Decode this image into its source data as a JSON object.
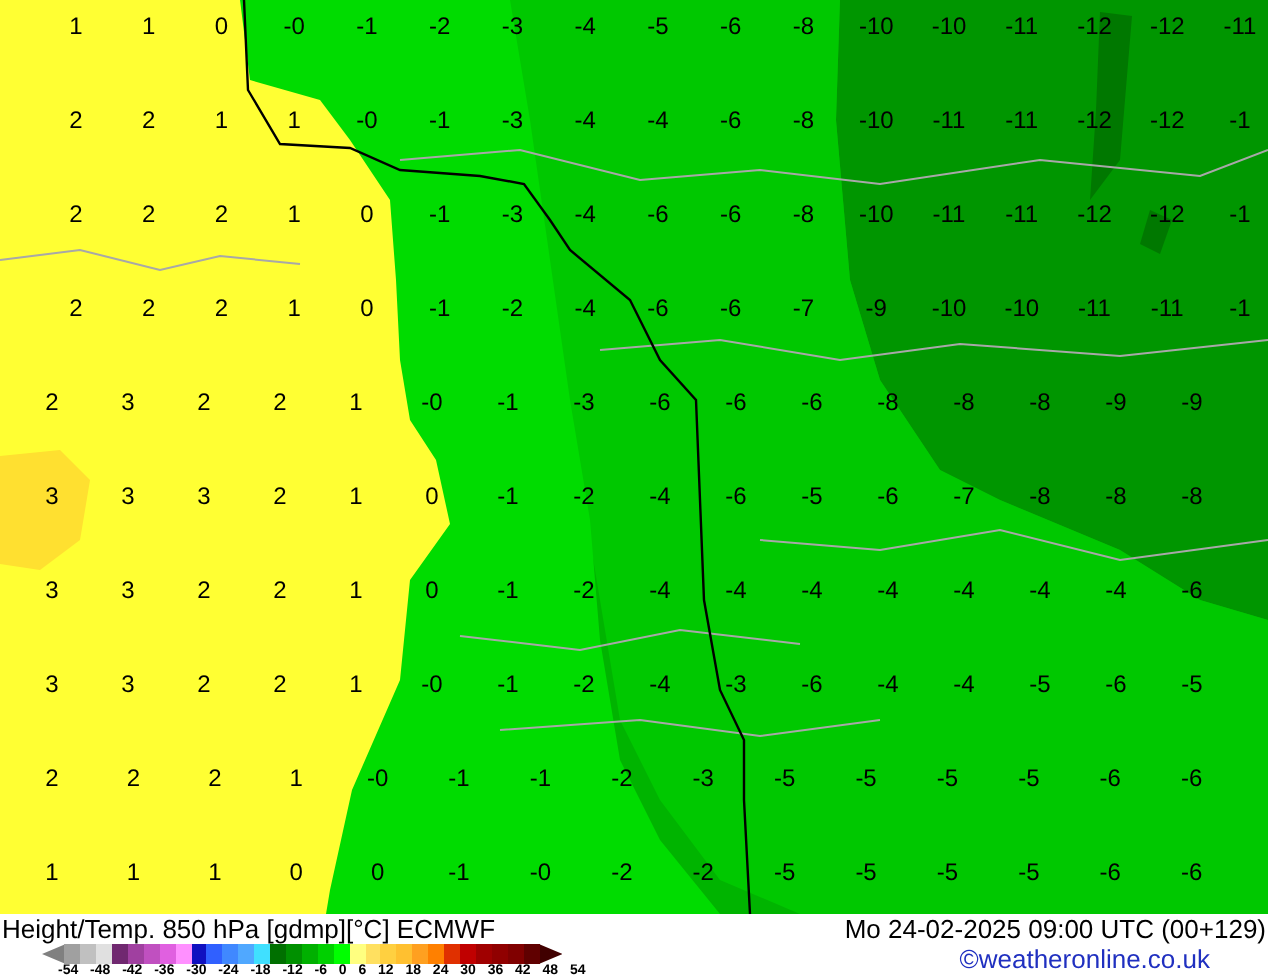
{
  "map": {
    "rows": [
      [
        "1",
        "1",
        "0",
        "-0",
        "-1",
        "-2",
        "-3",
        "-4",
        "-5",
        "-6",
        "-8",
        "-10",
        "-10",
        "-11",
        "-12",
        "-12",
        "-11"
      ],
      [
        "2",
        "2",
        "1",
        "1",
        "-0",
        "-1",
        "-3",
        "-4",
        "-4",
        "-6",
        "-8",
        "-10",
        "-11",
        "-11",
        "-12",
        "-12",
        "-1"
      ],
      [
        "2",
        "2",
        "2",
        "1",
        "0",
        "-1",
        "-3",
        "-4",
        "-6",
        "-6",
        "-8",
        "-10",
        "-11",
        "-11",
        "-12",
        "-12",
        "-1"
      ],
      [
        "2",
        "2",
        "2",
        "1",
        "0",
        "-1",
        "-2",
        "-4",
        "-6",
        "-6",
        "-7",
        "-9",
        "-10",
        "-10",
        "-11",
        "-11",
        "-1"
      ],
      [
        "2",
        "3",
        "2",
        "2",
        "1",
        "-0",
        "-1",
        "-3",
        "-6",
        "-6",
        "-6",
        "-8",
        "-8",
        "-8",
        "-9",
        "-9"
      ],
      [
        "3",
        "3",
        "3",
        "2",
        "1",
        "0",
        "-1",
        "-2",
        "-4",
        "-6",
        "-5",
        "-6",
        "-7",
        "-8",
        "-8",
        "-8"
      ],
      [
        "3",
        "3",
        "2",
        "2",
        "1",
        "0",
        "-1",
        "-2",
        "-4",
        "-4",
        "-4",
        "-4",
        "-4",
        "-4",
        "-4",
        "-6"
      ],
      [
        "3",
        "3",
        "2",
        "2",
        "1",
        "-0",
        "-1",
        "-2",
        "-4",
        "-3",
        "-6",
        "-4",
        "-4",
        "-5",
        "-6",
        "-5"
      ],
      [
        "2",
        "2",
        "2",
        "1",
        "-0",
        "-1",
        "-1",
        "-2",
        "-3",
        "-5",
        "-5",
        "-5",
        "-5",
        "-6",
        "-6"
      ],
      [
        "1",
        "1",
        "1",
        "0",
        "0",
        "-1",
        "-0",
        "-2",
        "-2",
        "-5",
        "-5",
        "-5",
        "-5",
        "-6",
        "-6"
      ]
    ]
  },
  "footer": {
    "title": "Height/Temp. 850 hPa [gdmp][°C] ECMWF",
    "datetime": "Mo 24-02-2025 09:00 UTC (00+129)",
    "legend": {
      "swatches": [
        {
          "color": "#808080"
        },
        {
          "color": "#a0a0a0"
        },
        {
          "color": "#c0c0c0"
        },
        {
          "color": "#e0e0e0"
        },
        {
          "color": "#702870"
        },
        {
          "color": "#a040a0"
        },
        {
          "color": "#c050c0"
        },
        {
          "color": "#e060e0"
        },
        {
          "color": "#ff90ff"
        },
        {
          "color": "#1010c0"
        },
        {
          "color": "#3060ff"
        },
        {
          "color": "#4088ff"
        },
        {
          "color": "#50a8ff"
        },
        {
          "color": "#40e0ff"
        },
        {
          "color": "#007000"
        },
        {
          "color": "#009000"
        },
        {
          "color": "#00b000"
        },
        {
          "color": "#00d000"
        },
        {
          "color": "#00ff00"
        },
        {
          "color": "#ffff80"
        },
        {
          "color": "#ffe060"
        },
        {
          "color": "#ffd040"
        },
        {
          "color": "#ffc030"
        },
        {
          "color": "#ffa020"
        },
        {
          "color": "#ff8000"
        },
        {
          "color": "#e03000"
        },
        {
          "color": "#c00000"
        },
        {
          "color": "#a00000"
        },
        {
          "color": "#900000"
        },
        {
          "color": "#800000"
        },
        {
          "color": "#600000"
        },
        {
          "color": "#400000"
        }
      ],
      "ticks": [
        "-54",
        "-48",
        "-42",
        "-36",
        "-30",
        "-24",
        "-18",
        "-12",
        "-6",
        "0",
        "6",
        "12",
        "18",
        "24",
        "30",
        "36",
        "42",
        "48",
        "54"
      ]
    },
    "credit": "©weatheronline.co.uk"
  }
}
